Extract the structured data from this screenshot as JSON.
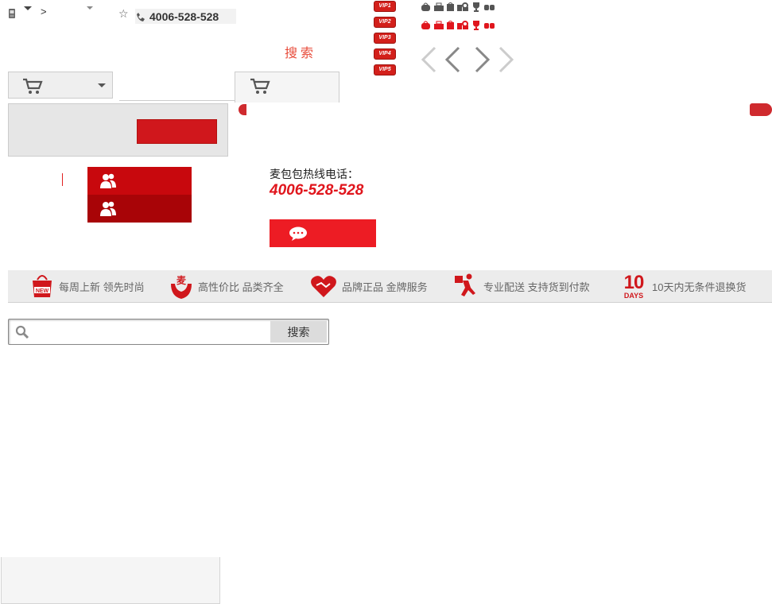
{
  "topbar": {
    "nav_arrow": ">",
    "hotline": "4006-528-528"
  },
  "header": {
    "search_label": "搜索"
  },
  "vip_levels": [
    "VIP1",
    "VIP2",
    "VIP3",
    "VIP4",
    "VIP5"
  ],
  "level_icons": {
    "row1_color": "#555555",
    "row2_color": "#e0161d"
  },
  "carousel": {
    "prev_icons": [
      "chevron-left-light-icon",
      "chevron-left-dark-icon"
    ],
    "next_icons": [
      "chevron-right-dark-icon",
      "chevron-right-light-icon"
    ]
  },
  "hotline_block": {
    "title": "麦包包热线电话：",
    "number": "4006-528-528"
  },
  "services": [
    {
      "icon": "new-bag-icon",
      "label": "每周上新 领先时尚"
    },
    {
      "icon": "mai-hands-icon",
      "label": "高性价比 品类齐全"
    },
    {
      "icon": "handshake-heart-icon",
      "label": "品牌正品 金牌服务"
    },
    {
      "icon": "delivery-runner-icon",
      "label": "专业配送 支持货到付款"
    },
    {
      "icon": "10-days-icon",
      "label": "10天内无条件退换货",
      "badge_top": "10",
      "badge_bottom": "DAYS"
    }
  ],
  "search": {
    "placeholder": "",
    "button_label": "搜索"
  },
  "colors": {
    "brand_red": "#d0171c",
    "hotline_red": "#e0161d",
    "search_orange": "#e84b3a"
  }
}
